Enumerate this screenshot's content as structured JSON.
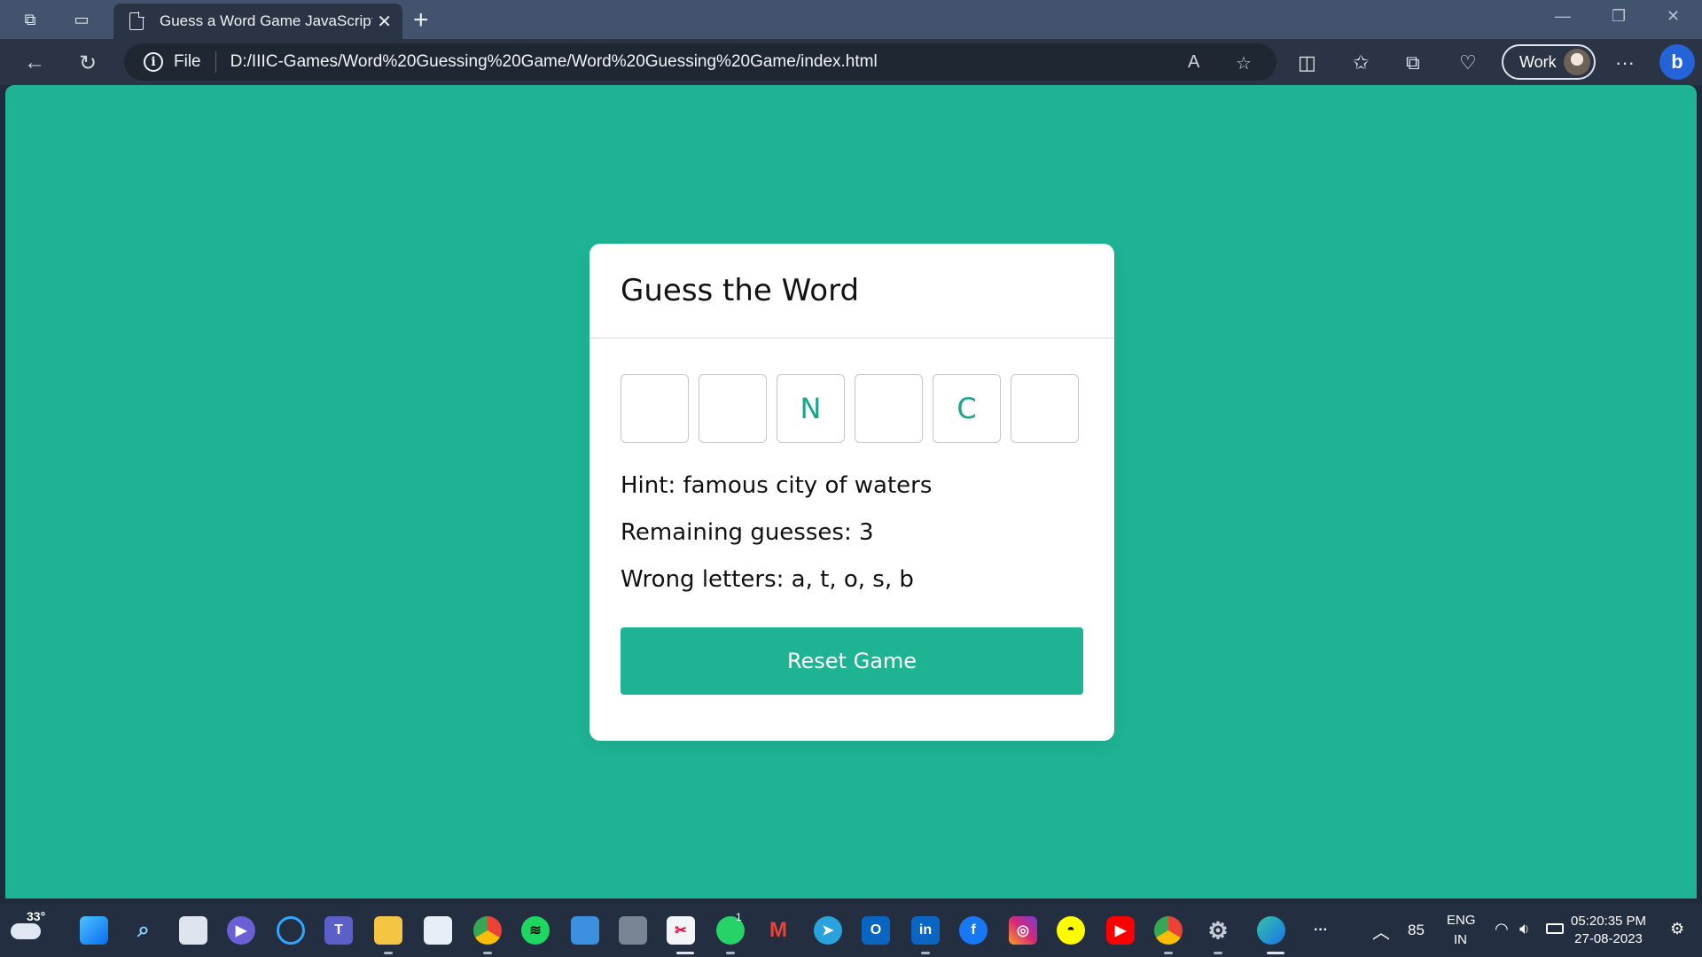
{
  "browser": {
    "tab_title": "Guess a Word Game JavaScript |",
    "file_label": "File",
    "url": "D:/IIIC-Games/Word%20Guessing%20Game/Word%20Guessing%20Game/index.html",
    "profile_label": "Work"
  },
  "game": {
    "title": "Guess the Word",
    "letters": [
      "",
      "",
      "N",
      "",
      "C",
      ""
    ],
    "hint": "Hint: famous city of waters",
    "remaining": "Remaining guesses: 3",
    "wrong": "Wrong letters: a, t, o, s, b",
    "reset_label": "Reset Game",
    "accent": "#1db393"
  },
  "taskbar": {
    "weather_temp": "33°",
    "whatsapp_badge": "1",
    "battery": "85",
    "lang_top": "ENG",
    "lang_bottom": "IN",
    "time": "05:20:35 PM",
    "date": "27-08-2023"
  }
}
